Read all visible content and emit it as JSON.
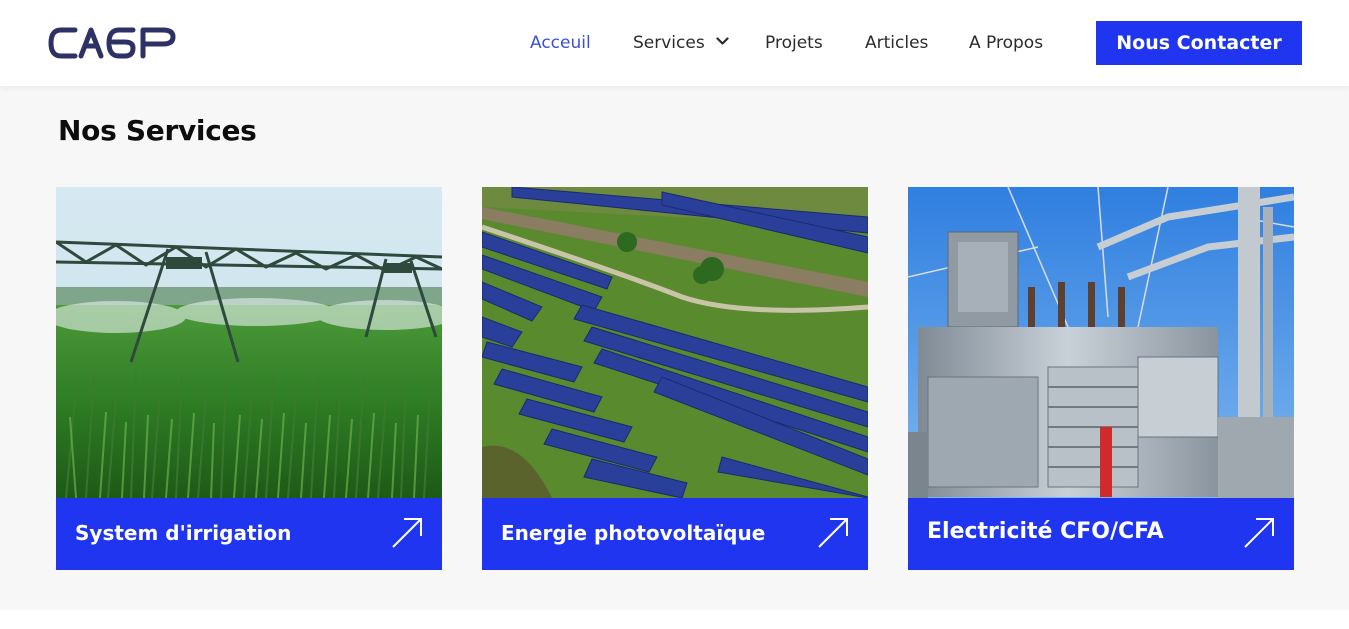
{
  "header": {
    "logo_text": "CA6P",
    "nav": [
      {
        "label": "Acceuil",
        "active": true
      },
      {
        "label": "Services",
        "has_dropdown": true
      },
      {
        "label": "Projets"
      },
      {
        "label": "Articles"
      },
      {
        "label": "A Propos"
      }
    ],
    "cta_label": "Nous Contacter"
  },
  "services": {
    "title": "Nos Services",
    "cards": [
      {
        "label": "System d'irrigation",
        "image": "irrigation-field-photo",
        "icon": "arrow-up-right-icon"
      },
      {
        "label": "Energie photovoltaïque",
        "image": "solar-farm-photo",
        "icon": "arrow-up-right-icon"
      },
      {
        "label": "Electricité CFO/CFA",
        "image": "electrical-substation-photo",
        "icon": "arrow-up-right-icon"
      }
    ]
  },
  "colors": {
    "accent": "#1f35f0",
    "nav_active": "#3c4fd6",
    "logo": "#2d3163",
    "section_bg": "#f7f7f7"
  }
}
